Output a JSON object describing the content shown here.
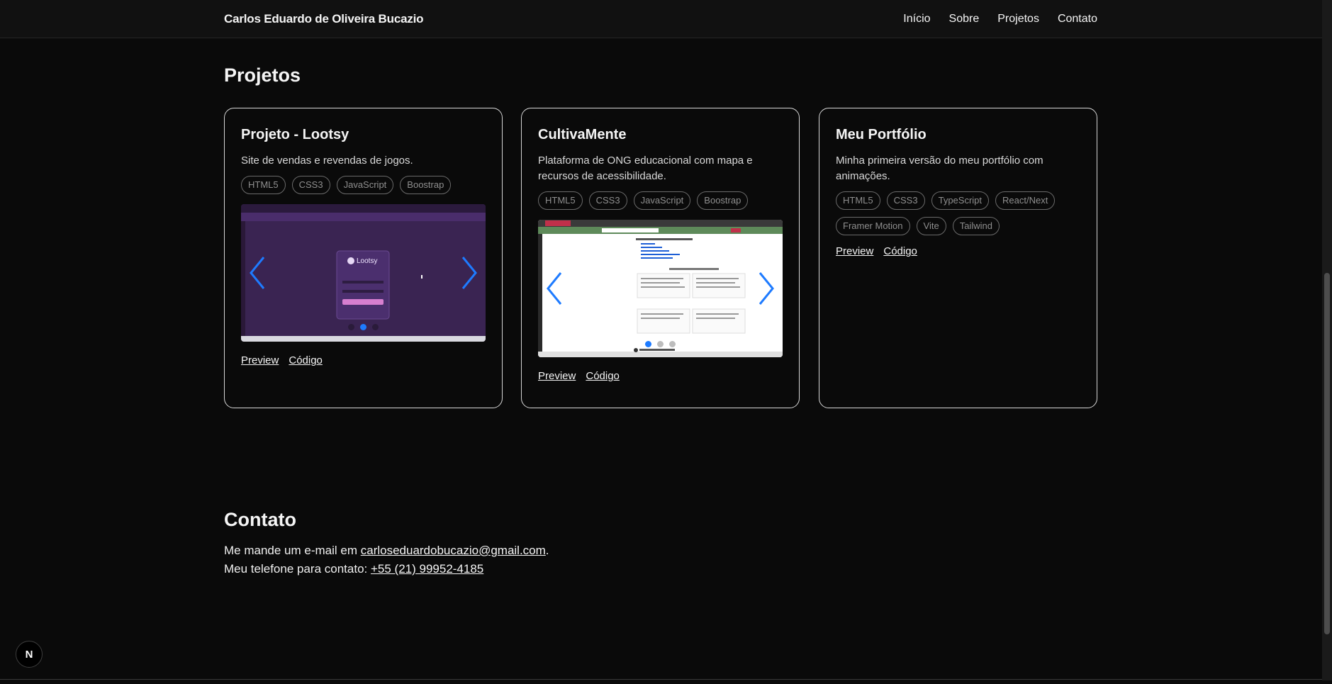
{
  "header": {
    "brand": "Carlos Eduardo de Oliveira Bucazio",
    "nav": [
      "Início",
      "Sobre",
      "Projetos",
      "Contato"
    ]
  },
  "projects_section": {
    "title": "Projetos",
    "cards": [
      {
        "title": "Projeto - Lootsy",
        "description": "Site de vendas e revendas de jogos.",
        "tags": [
          "HTML5",
          "CSS3",
          "JavaScript",
          "Boostrap"
        ],
        "screenshot_logo": "Lootsy",
        "preview_label": "Preview",
        "code_label": "Código"
      },
      {
        "title": "CultivaMente",
        "description": "Plataforma de ONG educacional com mapa e recursos de acessibilidade.",
        "tags": [
          "HTML5",
          "CSS3",
          "JavaScript",
          "Boostrap"
        ],
        "preview_label": "Preview",
        "code_label": "Código"
      },
      {
        "title": "Meu Portfólio",
        "description": "Minha primeira versão do meu portfólio com animações.",
        "tags": [
          "HTML5",
          "CSS3",
          "TypeScript",
          "React/Next",
          "Framer Motion",
          "Vite",
          "Tailwind"
        ],
        "preview_label": "Preview",
        "code_label": "Código"
      }
    ]
  },
  "contact_section": {
    "title": "Contato",
    "email_prefix": "Me mande um e-mail em ",
    "email": "carloseduardobucazio@gmail.com",
    "email_suffix": ".",
    "phone_prefix": "Meu telefone para contato: ",
    "phone": "+55 (21) 99952-4185"
  },
  "dev_badge": "N",
  "colors": {
    "background": "#0a0a0a",
    "accent_arrow": "#1e7bff",
    "card_border": "#d6d6d6"
  }
}
